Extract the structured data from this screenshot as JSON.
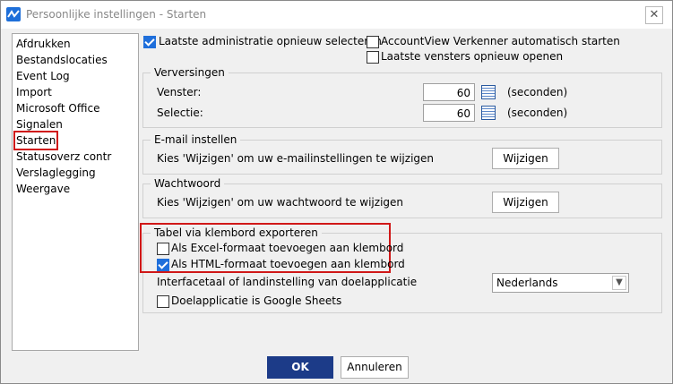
{
  "window": {
    "title": "Persoonlijke instellingen - Starten"
  },
  "sidebar": {
    "items": [
      {
        "label": "Afdrukken"
      },
      {
        "label": "Bestandslocaties"
      },
      {
        "label": "Event Log"
      },
      {
        "label": "Import"
      },
      {
        "label": "Microsoft Office"
      },
      {
        "label": "Signalen"
      },
      {
        "label": "Starten",
        "selected": true
      },
      {
        "label": "Statusoverz contr"
      },
      {
        "label": "Verslaglegging"
      },
      {
        "label": "Weergave"
      }
    ]
  },
  "options": {
    "laatste_administratie": {
      "label": "Laatste administratie opnieuw selecteren",
      "checked": true
    },
    "verkenner_auto": {
      "label": "AccountView Verkenner automatisch starten",
      "checked": false
    },
    "laatste_vensters": {
      "label": "Laatste vensters opnieuw openen",
      "checked": false
    }
  },
  "verversingen": {
    "title": "Verversingen",
    "venster_label": "Venster:",
    "venster_value": "60",
    "venster_unit": "(seconden)",
    "selectie_label": "Selectie:",
    "selectie_value": "60",
    "selectie_unit": "(seconden)"
  },
  "email": {
    "title": "E-mail instellen",
    "text": "Kies 'Wijzigen' om uw e-mailinstellingen te wijzigen",
    "button": "Wijzigen"
  },
  "wachtwoord": {
    "title": "Wachtwoord",
    "text": "Kies 'Wijzigen' om uw wachtwoord te wijzigen",
    "button": "Wijzigen"
  },
  "klembord": {
    "title": "Tabel via klembord exporteren",
    "excel": {
      "label": "Als Excel-formaat toevoegen aan klembord",
      "checked": false
    },
    "html": {
      "label": "Als HTML-formaat toevoegen aan klembord",
      "checked": true
    },
    "interfacetaal_label": "Interfacetaal of landinstelling van doelapplicatie",
    "interfacetaal_value": "Nederlands",
    "google": {
      "label": "Doelapplicatie is Google Sheets",
      "checked": false
    }
  },
  "footer": {
    "ok": "OK",
    "cancel": "Annuleren"
  },
  "colors": {
    "accent": "#1f6fdb",
    "primary_button": "#1c3b88",
    "highlight": "#d01818"
  }
}
